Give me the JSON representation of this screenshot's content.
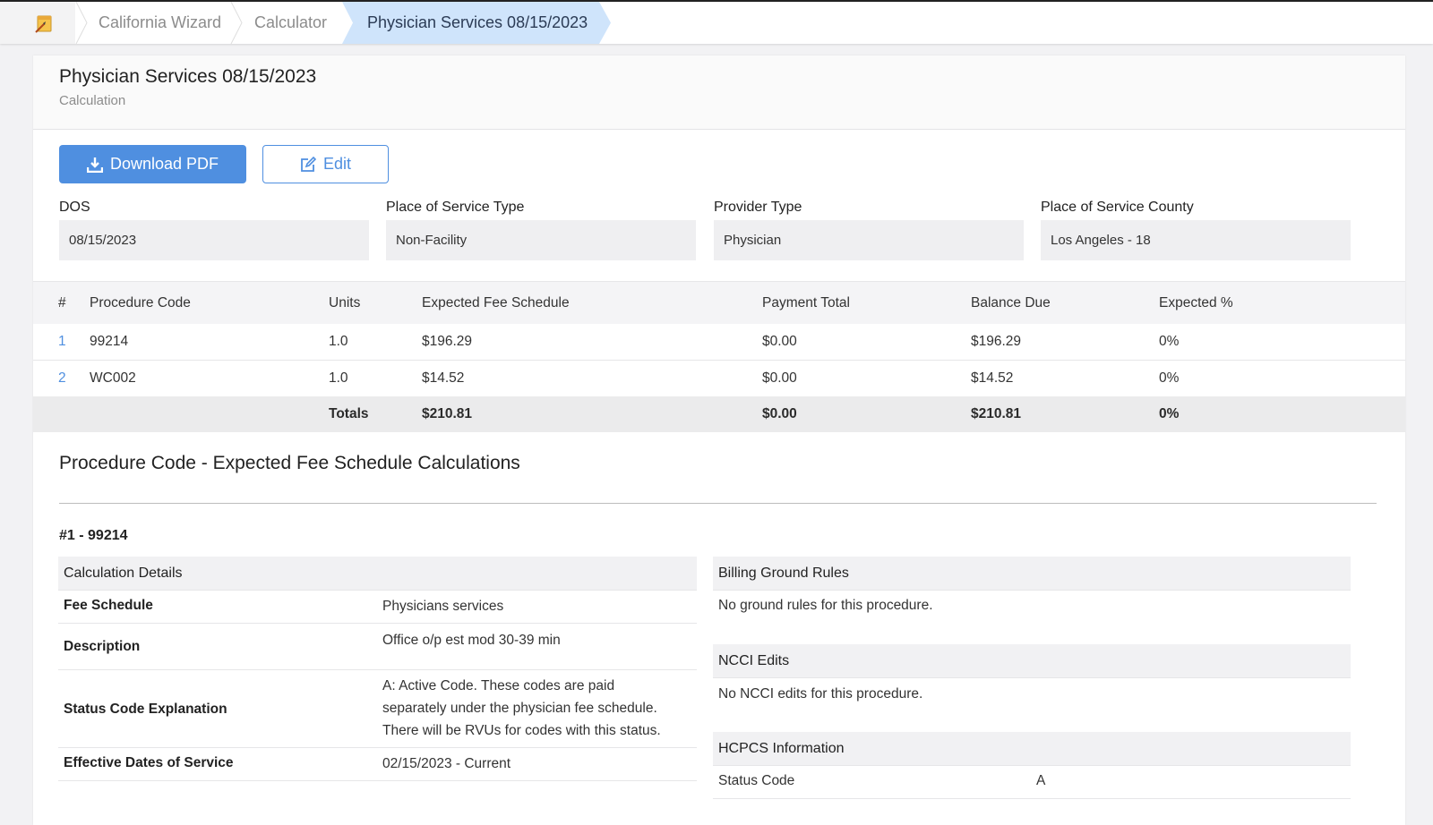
{
  "breadcrumbs": {
    "home_icon": "home-icon",
    "items": [
      "California Wizard",
      "Calculator"
    ],
    "active": "Physician Services 08/15/2023"
  },
  "header": {
    "title": "Physician Services 08/15/2023",
    "subtitle": "Calculation"
  },
  "actions": {
    "download_label": "Download PDF",
    "download_icon": "download-icon",
    "edit_label": "Edit",
    "edit_icon": "edit-icon"
  },
  "fields": [
    {
      "label": "DOS",
      "value": "08/15/2023"
    },
    {
      "label": "Place of Service Type",
      "value": "Non-Facility"
    },
    {
      "label": "Provider Type",
      "value": "Physician"
    },
    {
      "label": "Place of Service County",
      "value": "Los Angeles - 18"
    }
  ],
  "table": {
    "headers": [
      "#",
      "Procedure Code",
      "Units",
      "Expected Fee Schedule",
      "Payment Total",
      "Balance Due",
      "Expected %"
    ],
    "rows": [
      {
        "num": "1",
        "code": "99214",
        "units": "1.0",
        "expected": "$196.29",
        "payment": "$0.00",
        "balance": "$196.29",
        "pct": "0%"
      },
      {
        "num": "2",
        "code": "WC002",
        "units": "1.0",
        "expected": "$14.52",
        "payment": "$0.00",
        "balance": "$14.52",
        "pct": "0%"
      }
    ],
    "totals": {
      "label": "Totals",
      "expected": "$210.81",
      "payment": "$0.00",
      "balance": "$210.81",
      "pct": "0%"
    }
  },
  "calc_section": {
    "title": "Procedure Code - Expected Fee Schedule Calculations",
    "procedure_id": "#1 - 99214",
    "details": {
      "heading": "Calculation Details",
      "rows": [
        {
          "key": "Fee Schedule",
          "value": "Physicians services"
        },
        {
          "key": "Description",
          "value": "Office o/p est mod 30-39 min"
        },
        {
          "key": "Status Code Explanation",
          "lines": [
            "A: Active Code. These codes are paid",
            "separately under the physician fee schedule.",
            "There will be RVUs for codes with this status."
          ]
        },
        {
          "key": "Effective Dates of Service",
          "value": "02/15/2023 - Current"
        }
      ]
    },
    "billing": {
      "heading": "Billing Ground Rules",
      "text": "No ground rules for this procedure."
    },
    "ncci": {
      "heading": "NCCI Edits",
      "text": "No NCCI edits for this procedure."
    },
    "hcpcs": {
      "heading": "HCPCS Information",
      "status_key": "Status Code",
      "status_value": "A"
    }
  },
  "colors": {
    "accent": "#4f8fe0",
    "active_crumb": "#cfe4fb"
  }
}
